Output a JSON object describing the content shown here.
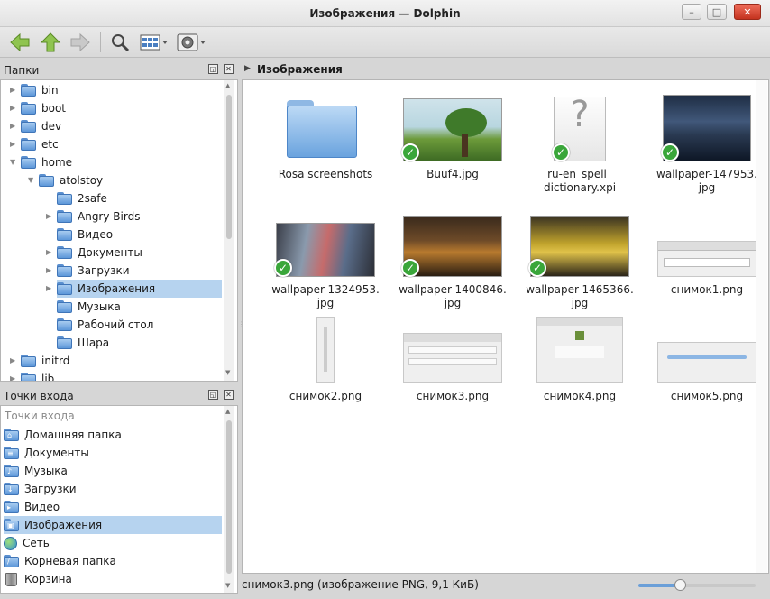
{
  "window": {
    "title": "Изображения — Dolphin",
    "minimize_label": "–",
    "maximize_label": "□",
    "close_label": "✕"
  },
  "toolbar": {
    "back_icon": "back-arrow-icon",
    "up_icon": "up-arrow-icon",
    "forward_icon": "forward-arrow-icon",
    "search_icon": "search-icon",
    "view_mode_icon": "view-mode-icon",
    "settings_icon": "settings-icon",
    "accent_green": "#7cb83a"
  },
  "folders_panel": {
    "title": "Папки",
    "items": [
      {
        "label": "bin",
        "depth": 0,
        "expander": "▶"
      },
      {
        "label": "boot",
        "depth": 0,
        "expander": "▶"
      },
      {
        "label": "dev",
        "depth": 0,
        "expander": "▶"
      },
      {
        "label": "etc",
        "depth": 0,
        "expander": "▶"
      },
      {
        "label": "home",
        "depth": 0,
        "expander": "▼"
      },
      {
        "label": "atolstoy",
        "depth": 1,
        "expander": "▼"
      },
      {
        "label": "2safe",
        "depth": 2,
        "expander": ""
      },
      {
        "label": "Angry Birds",
        "depth": 2,
        "expander": "▶"
      },
      {
        "label": "Видео",
        "depth": 2,
        "expander": ""
      },
      {
        "label": "Документы",
        "depth": 2,
        "expander": "▶"
      },
      {
        "label": "Загрузки",
        "depth": 2,
        "expander": "▶"
      },
      {
        "label": "Изображения",
        "depth": 2,
        "expander": "▶",
        "selected": true
      },
      {
        "label": "Музыка",
        "depth": 2,
        "expander": ""
      },
      {
        "label": "Рабочий стол",
        "depth": 2,
        "expander": ""
      },
      {
        "label": "Шара",
        "depth": 2,
        "expander": ""
      },
      {
        "label": "initrd",
        "depth": 0,
        "expander": "▶"
      },
      {
        "label": "lib",
        "depth": 0,
        "expander": "▶"
      }
    ]
  },
  "places_panel": {
    "title": "Точки входа",
    "section": "Точки входа",
    "items": [
      {
        "label": "Домашняя папка",
        "icon": "home-folder-icon"
      },
      {
        "label": "Документы",
        "icon": "documents-folder-icon"
      },
      {
        "label": "Музыка",
        "icon": "music-folder-icon"
      },
      {
        "label": "Загрузки",
        "icon": "downloads-folder-icon"
      },
      {
        "label": "Видео",
        "icon": "video-folder-icon"
      },
      {
        "label": "Изображения",
        "icon": "pictures-folder-icon",
        "selected": true
      },
      {
        "label": "Сеть",
        "icon": "network-icon"
      },
      {
        "label": "Корневая папка",
        "icon": "root-folder-icon"
      },
      {
        "label": "Корзина",
        "icon": "trash-icon"
      }
    ]
  },
  "location": {
    "path": "Изображения"
  },
  "files": [
    {
      "name": "Rosa screenshots",
      "kind": "folder"
    },
    {
      "name": "Buuf4.jpg",
      "kind": "image",
      "synced": true
    },
    {
      "name": "ru-en_spell_\ndictionary.xpi",
      "kind": "unknown",
      "synced": true
    },
    {
      "name": "wallpaper-147953.\njpg",
      "kind": "image",
      "synced": true
    },
    {
      "name": "wallpaper-1324953.\njpg",
      "kind": "image",
      "synced": true
    },
    {
      "name": "wallpaper-1400846.\njpg",
      "kind": "image",
      "synced": true
    },
    {
      "name": "wallpaper-1465366.\njpg",
      "kind": "image",
      "synced": true
    },
    {
      "name": "снимок1.png",
      "kind": "image"
    },
    {
      "name": "снимок2.png",
      "kind": "image"
    },
    {
      "name": "снимок3.png",
      "kind": "image"
    },
    {
      "name": "снимок4.png",
      "kind": "image"
    },
    {
      "name": "снимок5.png",
      "kind": "image"
    }
  ],
  "status": {
    "text": "снимок3.png (изображение PNG, 9,1 КиБ)",
    "zoom_fraction": 0.36
  }
}
